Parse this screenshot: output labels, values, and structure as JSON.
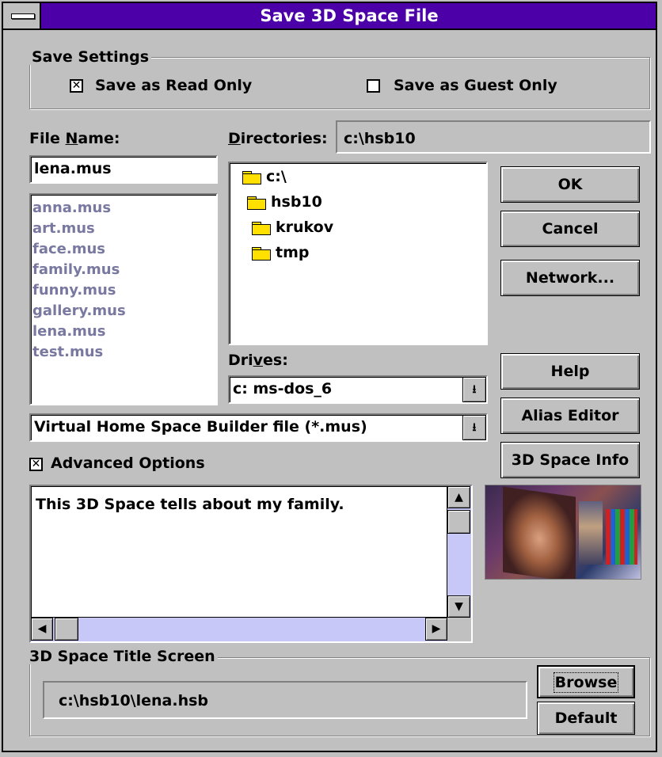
{
  "window": {
    "title": "Save 3D Space File"
  },
  "save_settings": {
    "group_label": "Save Settings",
    "read_only": {
      "label": "Save as Read Only",
      "checked": true
    },
    "guest_only": {
      "label": "Save as Guest Only",
      "checked": false
    }
  },
  "file_name": {
    "label_pre": "File ",
    "label_accel": "N",
    "label_post": "ame:",
    "value": "lena.mus",
    "files": [
      "anna.mus",
      "art.mus",
      "face.mus",
      "family.mus",
      "funny.mus",
      "gallery.mus",
      "lena.mus",
      "test.mus"
    ]
  },
  "directories": {
    "label_accel": "D",
    "label_post": "irectories:",
    "current_path": "c:\\hsb10",
    "tree": [
      {
        "name": "c:\\",
        "state": "open"
      },
      {
        "name": "hsb10",
        "state": "open"
      },
      {
        "name": "krukov",
        "state": "closed"
      },
      {
        "name": "tmp",
        "state": "closed"
      }
    ]
  },
  "drives": {
    "label_pre": "Dri",
    "label_accel": "v",
    "label_post": "es:",
    "value": "c: ms-dos_6"
  },
  "file_type": {
    "value": "Virtual Home Space Builder file (*.mus)"
  },
  "buttons": {
    "ok": "OK",
    "cancel": "Cancel",
    "network": "Network...",
    "help": "Help",
    "alias_editor": "Alias Editor",
    "space_info": "3D Space Info",
    "browse": "Browse",
    "default": "Default"
  },
  "advanced": {
    "label": "Advanced Options",
    "checked": true
  },
  "description": {
    "text": "This 3D Space tells about my family."
  },
  "title_screen": {
    "group_label": "3D Space Title Screen",
    "path": "c:\\hsb10\\lena.hsb"
  },
  "colors": {
    "title_bar": "#4b00a8",
    "dialog": "#c0c0c0",
    "scroll_track": "#c8c8f8",
    "list_text": "#7878a0"
  }
}
